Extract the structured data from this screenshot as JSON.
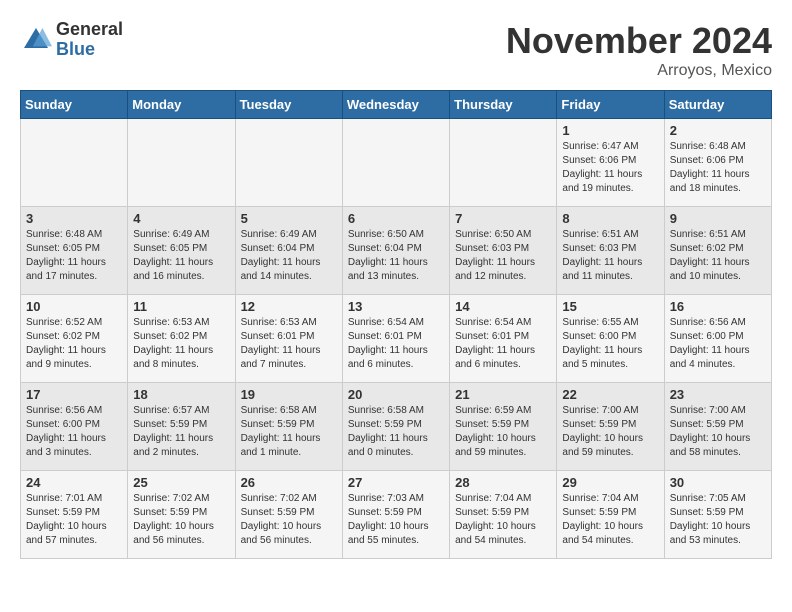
{
  "logo": {
    "general": "General",
    "blue": "Blue"
  },
  "title": "November 2024",
  "location": "Arroyos, Mexico",
  "days_of_week": [
    "Sunday",
    "Monday",
    "Tuesday",
    "Wednesday",
    "Thursday",
    "Friday",
    "Saturday"
  ],
  "weeks": [
    [
      {
        "day": "",
        "lines": []
      },
      {
        "day": "",
        "lines": []
      },
      {
        "day": "",
        "lines": []
      },
      {
        "day": "",
        "lines": []
      },
      {
        "day": "",
        "lines": []
      },
      {
        "day": "1",
        "lines": [
          "Sunrise: 6:47 AM",
          "Sunset: 6:06 PM",
          "Daylight: 11 hours",
          "and 19 minutes."
        ]
      },
      {
        "day": "2",
        "lines": [
          "Sunrise: 6:48 AM",
          "Sunset: 6:06 PM",
          "Daylight: 11 hours",
          "and 18 minutes."
        ]
      }
    ],
    [
      {
        "day": "3",
        "lines": [
          "Sunrise: 6:48 AM",
          "Sunset: 6:05 PM",
          "Daylight: 11 hours",
          "and 17 minutes."
        ]
      },
      {
        "day": "4",
        "lines": [
          "Sunrise: 6:49 AM",
          "Sunset: 6:05 PM",
          "Daylight: 11 hours",
          "and 16 minutes."
        ]
      },
      {
        "day": "5",
        "lines": [
          "Sunrise: 6:49 AM",
          "Sunset: 6:04 PM",
          "Daylight: 11 hours",
          "and 14 minutes."
        ]
      },
      {
        "day": "6",
        "lines": [
          "Sunrise: 6:50 AM",
          "Sunset: 6:04 PM",
          "Daylight: 11 hours",
          "and 13 minutes."
        ]
      },
      {
        "day": "7",
        "lines": [
          "Sunrise: 6:50 AM",
          "Sunset: 6:03 PM",
          "Daylight: 11 hours",
          "and 12 minutes."
        ]
      },
      {
        "day": "8",
        "lines": [
          "Sunrise: 6:51 AM",
          "Sunset: 6:03 PM",
          "Daylight: 11 hours",
          "and 11 minutes."
        ]
      },
      {
        "day": "9",
        "lines": [
          "Sunrise: 6:51 AM",
          "Sunset: 6:02 PM",
          "Daylight: 11 hours",
          "and 10 minutes."
        ]
      }
    ],
    [
      {
        "day": "10",
        "lines": [
          "Sunrise: 6:52 AM",
          "Sunset: 6:02 PM",
          "Daylight: 11 hours",
          "and 9 minutes."
        ]
      },
      {
        "day": "11",
        "lines": [
          "Sunrise: 6:53 AM",
          "Sunset: 6:02 PM",
          "Daylight: 11 hours",
          "and 8 minutes."
        ]
      },
      {
        "day": "12",
        "lines": [
          "Sunrise: 6:53 AM",
          "Sunset: 6:01 PM",
          "Daylight: 11 hours",
          "and 7 minutes."
        ]
      },
      {
        "day": "13",
        "lines": [
          "Sunrise: 6:54 AM",
          "Sunset: 6:01 PM",
          "Daylight: 11 hours",
          "and 6 minutes."
        ]
      },
      {
        "day": "14",
        "lines": [
          "Sunrise: 6:54 AM",
          "Sunset: 6:01 PM",
          "Daylight: 11 hours",
          "and 6 minutes."
        ]
      },
      {
        "day": "15",
        "lines": [
          "Sunrise: 6:55 AM",
          "Sunset: 6:00 PM",
          "Daylight: 11 hours",
          "and 5 minutes."
        ]
      },
      {
        "day": "16",
        "lines": [
          "Sunrise: 6:56 AM",
          "Sunset: 6:00 PM",
          "Daylight: 11 hours",
          "and 4 minutes."
        ]
      }
    ],
    [
      {
        "day": "17",
        "lines": [
          "Sunrise: 6:56 AM",
          "Sunset: 6:00 PM",
          "Daylight: 11 hours",
          "and 3 minutes."
        ]
      },
      {
        "day": "18",
        "lines": [
          "Sunrise: 6:57 AM",
          "Sunset: 5:59 PM",
          "Daylight: 11 hours",
          "and 2 minutes."
        ]
      },
      {
        "day": "19",
        "lines": [
          "Sunrise: 6:58 AM",
          "Sunset: 5:59 PM",
          "Daylight: 11 hours",
          "and 1 minute."
        ]
      },
      {
        "day": "20",
        "lines": [
          "Sunrise: 6:58 AM",
          "Sunset: 5:59 PM",
          "Daylight: 11 hours",
          "and 0 minutes."
        ]
      },
      {
        "day": "21",
        "lines": [
          "Sunrise: 6:59 AM",
          "Sunset: 5:59 PM",
          "Daylight: 10 hours",
          "and 59 minutes."
        ]
      },
      {
        "day": "22",
        "lines": [
          "Sunrise: 7:00 AM",
          "Sunset: 5:59 PM",
          "Daylight: 10 hours",
          "and 59 minutes."
        ]
      },
      {
        "day": "23",
        "lines": [
          "Sunrise: 7:00 AM",
          "Sunset: 5:59 PM",
          "Daylight: 10 hours",
          "and 58 minutes."
        ]
      }
    ],
    [
      {
        "day": "24",
        "lines": [
          "Sunrise: 7:01 AM",
          "Sunset: 5:59 PM",
          "Daylight: 10 hours",
          "and 57 minutes."
        ]
      },
      {
        "day": "25",
        "lines": [
          "Sunrise: 7:02 AM",
          "Sunset: 5:59 PM",
          "Daylight: 10 hours",
          "and 56 minutes."
        ]
      },
      {
        "day": "26",
        "lines": [
          "Sunrise: 7:02 AM",
          "Sunset: 5:59 PM",
          "Daylight: 10 hours",
          "and 56 minutes."
        ]
      },
      {
        "day": "27",
        "lines": [
          "Sunrise: 7:03 AM",
          "Sunset: 5:59 PM",
          "Daylight: 10 hours",
          "and 55 minutes."
        ]
      },
      {
        "day": "28",
        "lines": [
          "Sunrise: 7:04 AM",
          "Sunset: 5:59 PM",
          "Daylight: 10 hours",
          "and 54 minutes."
        ]
      },
      {
        "day": "29",
        "lines": [
          "Sunrise: 7:04 AM",
          "Sunset: 5:59 PM",
          "Daylight: 10 hours",
          "and 54 minutes."
        ]
      },
      {
        "day": "30",
        "lines": [
          "Sunrise: 7:05 AM",
          "Sunset: 5:59 PM",
          "Daylight: 10 hours",
          "and 53 minutes."
        ]
      }
    ]
  ]
}
